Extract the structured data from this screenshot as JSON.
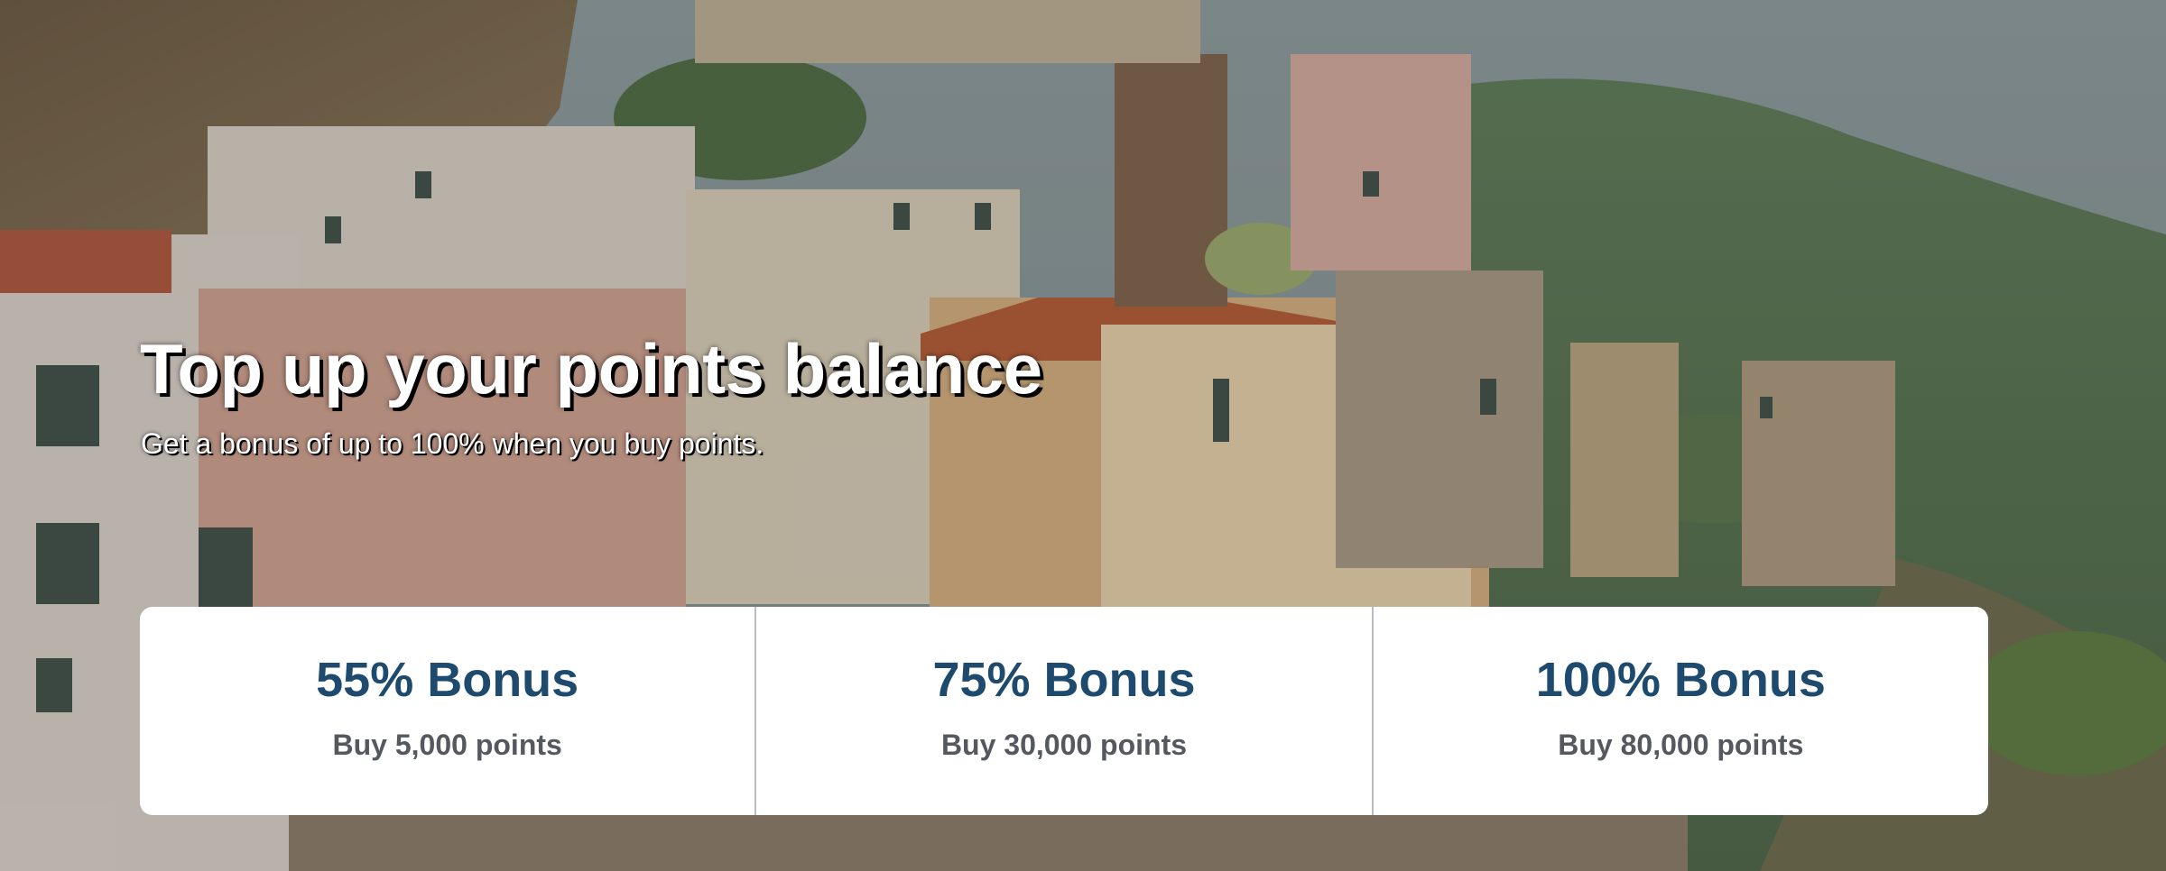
{
  "hero": {
    "title": "Top up your points balance",
    "subtitle": "Get a bonus of up to 100% when you buy points.",
    "background_image": "amalfi-coast-town-photo"
  },
  "offers": [
    {
      "title": "55% Bonus",
      "description": "Buy 5,000 points"
    },
    {
      "title": "75% Bonus",
      "description": "Buy 30,000 points"
    },
    {
      "title": "100% Bonus",
      "description": "Buy 80,000 points"
    }
  ],
  "colors": {
    "offer_title": "#1e4a6e",
    "offer_description": "#55595f",
    "card_background": "#ffffff"
  }
}
